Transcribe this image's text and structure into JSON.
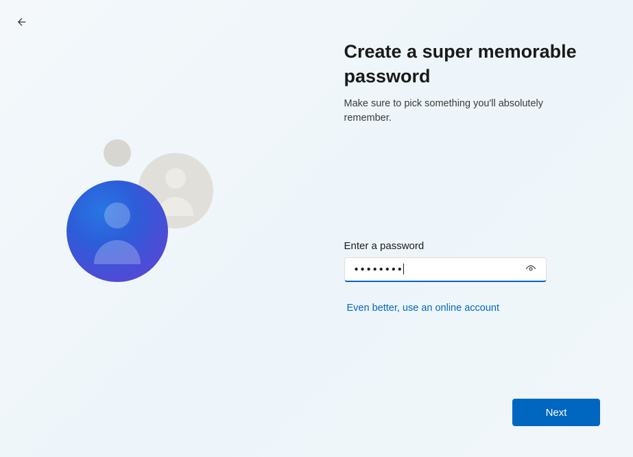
{
  "heading": "Create a super memorable password",
  "subheading": "Make sure to pick something you'll absolutely remember.",
  "form": {
    "password_label": "Enter a password",
    "password_value": "●●●●●●●●",
    "online_account_link": "Even better, use an online account"
  },
  "buttons": {
    "next": "Next"
  }
}
